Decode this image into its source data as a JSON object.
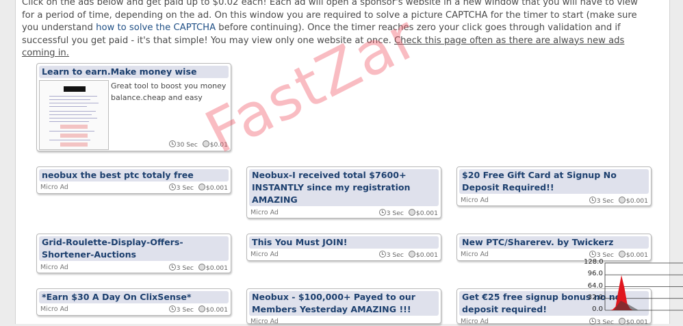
{
  "intro": {
    "part1": "Click on the ads below and get paid up to $0.02 each! Each ad will open a sponsor's website in a new window that you will have to view for a period of time, depending on the ad. On this window you are required to solve a picture CAPTCHA for the timer to start (make sure you understand ",
    "captcha_link": "how to solve the CAPTCHA",
    "part2": " before continuing). Once the timer reaches zero your click goes through validation and if successful you get paid - it's that simple! You may view only one website at once. ",
    "check_link": "Check this page often as there are always new ads coming in."
  },
  "featured_ad": {
    "title": "Learn to earn.Make money wise",
    "description": "Great tool to boost you money balance.cheap and easy",
    "time": "30 Sec",
    "amount": "$0.01",
    "thumbnail_lines": [
      "Mike Kiefer",
      "Mike Kiefer",
      "Mike Kiefer"
    ]
  },
  "ads": [
    {
      "title": "neobux the best ptc totaly free",
      "desc": "Micro Ad",
      "time": "3 Sec",
      "amount": "$0.001"
    },
    {
      "title": "Neobux-I received total $7600+ INSTANTLY since my registration AMAZING",
      "desc": "Micro Ad",
      "time": "3 Sec",
      "amount": "$0.001"
    },
    {
      "title": "$20 Free Gift Card at Signup No Deposit Required!!",
      "desc": "Micro Ad",
      "time": "3 Sec",
      "amount": "$0.001"
    },
    {
      "title": "Grid-Roulette-Display-Offers-Shortener-Auctions",
      "desc": "Micro Ad",
      "time": "3 Sec",
      "amount": "$0.001"
    },
    {
      "title": "This You Must JOIN!",
      "desc": "Micro Ad",
      "time": "3 Sec",
      "amount": "$0.001"
    },
    {
      "title": "New PTC/Sharerev. by Twickerz",
      "desc": "Micro Ad",
      "time": "3 Sec",
      "amount": "$0.001"
    },
    {
      "title": "*Earn $30 A Day On ClixSense*",
      "desc": "Micro Ad",
      "time": "3 Sec",
      "amount": "$0.001"
    },
    {
      "title": "Neobux - $100,000+ Payed to our Members Yesterday AMAZING !!!",
      "desc": "Micro Ad",
      "time": "3 Sec",
      "amount": "$0.001"
    },
    {
      "title": "Get €25 free signup bonus no no deposit required!",
      "desc": "Micro Ad",
      "time": "3 Sec",
      "amount": "$0.001"
    }
  ],
  "watermark": "FastZar",
  "chart_data": {
    "type": "area",
    "y_ticks": [
      "128.0",
      "96.0",
      "64.0",
      "32.0",
      "0.0"
    ],
    "ylim": [
      0,
      128
    ],
    "x": [
      0,
      1,
      2,
      3,
      4,
      5,
      6,
      7,
      8
    ],
    "values": [
      0,
      2,
      10,
      55,
      95,
      62,
      18,
      4,
      0
    ],
    "fill_color": "#e0171f"
  },
  "colors": {
    "title_bg": "#dfe1ec",
    "title_text": "#1c3f6e",
    "link": "#1f4f85",
    "watermark": "#f0505f"
  }
}
